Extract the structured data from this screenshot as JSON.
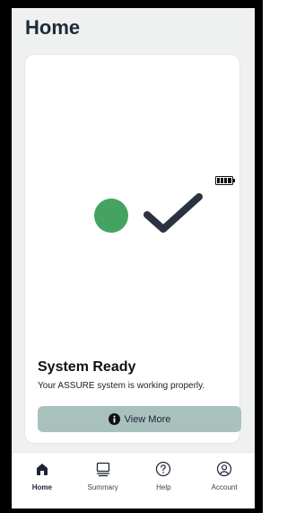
{
  "header": {
    "title": "Home"
  },
  "status": {
    "title": "System Ready",
    "description": "Your ASSURE system is working properly.",
    "indicator_color": "#44a360",
    "battery_icon": "battery-full-icon",
    "check_icon": "checkmark-icon"
  },
  "actions": {
    "view_more_label": "View More",
    "view_more_icon": "info-icon"
  },
  "tabbar": {
    "tabs": [
      {
        "label": "Home",
        "icon": "home-icon",
        "active": true
      },
      {
        "label": "Summary",
        "icon": "summary-icon",
        "active": false
      },
      {
        "label": "Help",
        "icon": "help-icon",
        "active": false
      },
      {
        "label": "Account",
        "icon": "account-icon",
        "active": false
      }
    ]
  },
  "colors": {
    "accent_button": "#a8c1bd",
    "background": "#eef1f0"
  }
}
